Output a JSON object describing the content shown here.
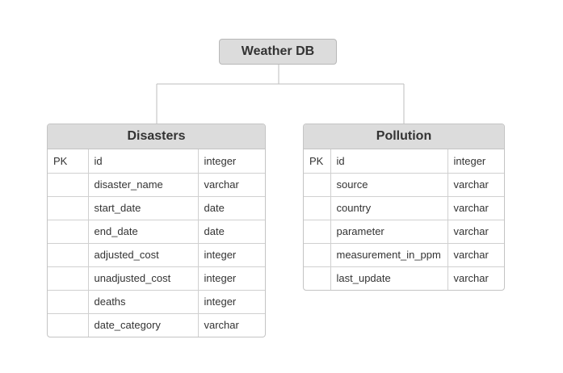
{
  "root": {
    "label": "Weather DB"
  },
  "tables": [
    {
      "name": "Disasters",
      "rows": [
        {
          "key": "PK",
          "column": "id",
          "type": "integer"
        },
        {
          "key": "",
          "column": "disaster_name",
          "type": "varchar"
        },
        {
          "key": "",
          "column": "start_date",
          "type": "date"
        },
        {
          "key": "",
          "column": "end_date",
          "type": "date"
        },
        {
          "key": "",
          "column": "adjusted_cost",
          "type": "integer"
        },
        {
          "key": "",
          "column": "unadjusted_cost",
          "type": "integer"
        },
        {
          "key": "",
          "column": "deaths",
          "type": "integer"
        },
        {
          "key": "",
          "column": "date_category",
          "type": "varchar"
        }
      ]
    },
    {
      "name": "Pollution",
      "rows": [
        {
          "key": "PK",
          "column": "id",
          "type": "integer"
        },
        {
          "key": "",
          "column": "source",
          "type": "varchar"
        },
        {
          "key": "",
          "column": "country",
          "type": "varchar"
        },
        {
          "key": "",
          "column": "parameter",
          "type": "varchar"
        },
        {
          "key": "",
          "column": "measurement_in_ppm",
          "type": "varchar"
        },
        {
          "key": "",
          "column": "last_update",
          "type": "varchar"
        }
      ]
    }
  ],
  "colors": {
    "header_fill": "#dcdcdc",
    "border": "#c4c4c4",
    "connector": "#bdbdbd",
    "text": "#333333"
  }
}
